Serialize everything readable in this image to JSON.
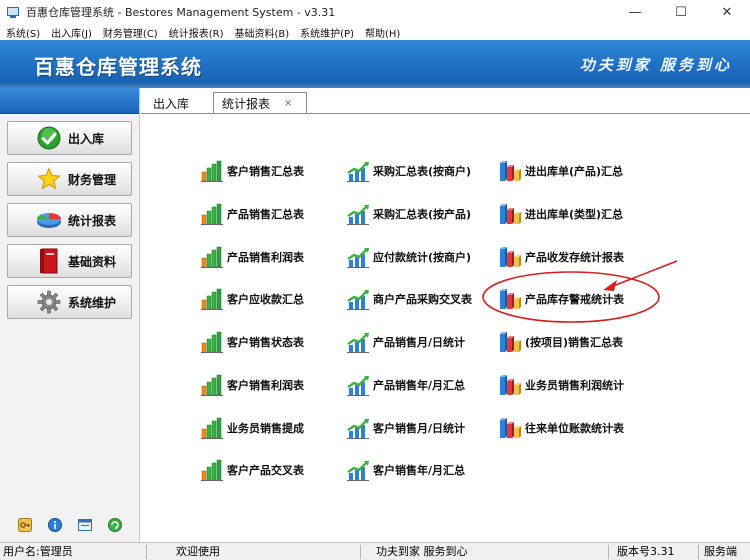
{
  "window": {
    "title": "百惠仓库管理系统 - Bestores Management System - v3.31",
    "controls": {
      "minimize": "—",
      "maximize": "☐",
      "close": "✕"
    }
  },
  "menu": [
    "系统(S)",
    "出入库(J)",
    "财务管理(C)",
    "统计报表(R)",
    "基础资料(B)",
    "系统维护(P)",
    "帮助(H)"
  ],
  "banner": {
    "title": "百惠仓库管理系统",
    "slogan": "功夫到家 服务到心"
  },
  "sidebar": {
    "items": [
      {
        "label": "出入库",
        "icon": "green-check-icon"
      },
      {
        "label": "财务管理",
        "icon": "star-icon"
      },
      {
        "label": "统计报表",
        "icon": "pie-chart-icon"
      },
      {
        "label": "基础资料",
        "icon": "book-icon"
      },
      {
        "label": "系统维护",
        "icon": "gear-icon"
      }
    ],
    "tools": [
      "key-icon",
      "info-icon",
      "window-icon",
      "refresh-icon"
    ]
  },
  "tabs": [
    {
      "label": "出入库",
      "active": false
    },
    {
      "label": "统计报表",
      "active": true,
      "close": "×"
    }
  ],
  "reports": {
    "col1": [
      "客户销售汇总表",
      "产品销售汇总表",
      "产品销售利润表",
      "客户应收款汇总",
      "客户销售状态表",
      "客户销售利润表",
      "业务员销售提成",
      "客户产品交叉表"
    ],
    "col2": [
      "采购汇总表(按商户)",
      "采购汇总表(按产品)",
      "应付款统计(按商户)",
      "商户产品采购交叉表",
      "产品销售月/日统计",
      "产品销售年/月汇总",
      "客户销售月/日统计",
      "客户销售年/月汇总"
    ],
    "col3": [
      "进出库单(产品)汇总",
      "进出库单(类型)汇总",
      "产品收发存统计报表",
      "产品库存警戒统计表",
      "(按项目)销售汇总表",
      "业务员销售利润统计",
      "往来单位账款统计表"
    ]
  },
  "colors": {
    "annotation": "#d42020",
    "banner": "#1f6fc4"
  },
  "status": {
    "user": "用户名:管理员",
    "welcome": "欢迎使用",
    "slogan": "功夫到家 服务到心",
    "version": "版本号3.31",
    "server": "服务端"
  }
}
